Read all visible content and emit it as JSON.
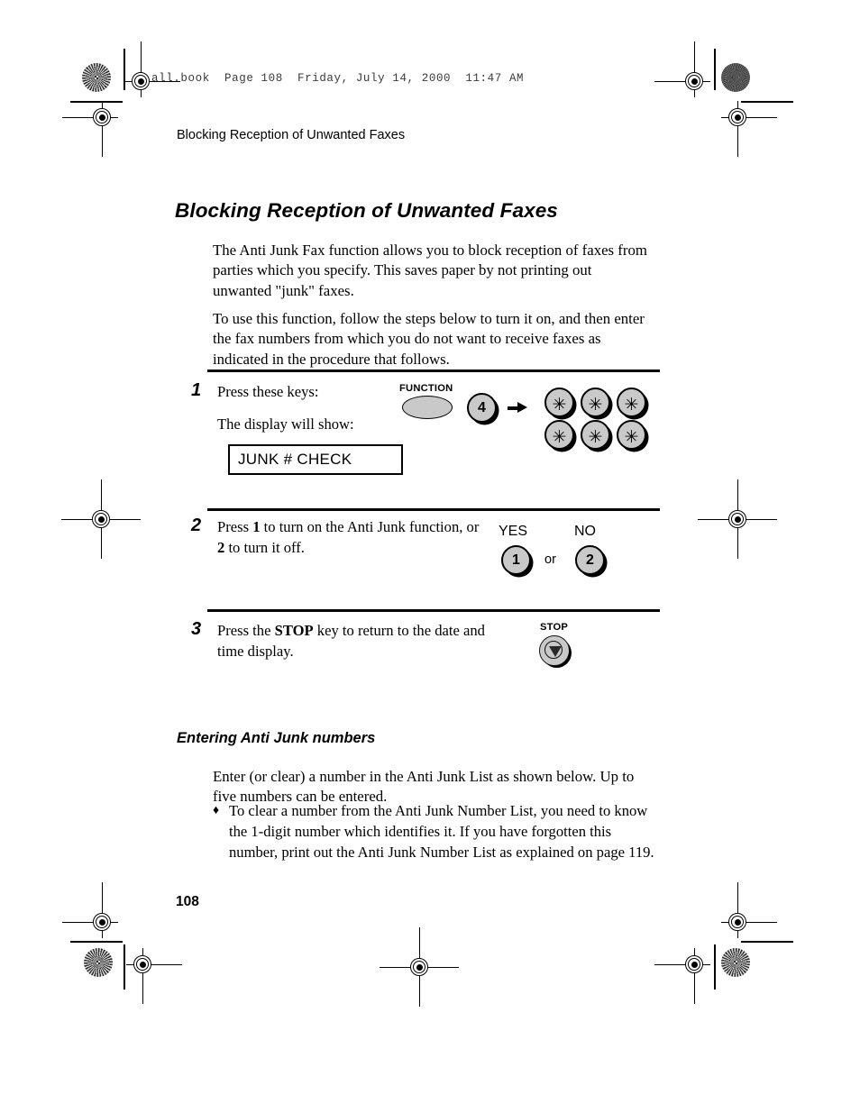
{
  "print_header": "all.book  Page 108  Friday, July 14, 2000  11:47 AM",
  "running_head": "Blocking Reception of Unwanted Faxes",
  "page_title": "Blocking Reception of Unwanted Faxes",
  "intro": {
    "paragraph_1": "The Anti Junk Fax function allows you to block reception of faxes from parties which you specify. This saves paper by not printing out unwanted \"junk\" faxes.",
    "paragraph_2": "To use this function, follow the steps below to turn it on, and then enter the fax numbers from which you do not want to receive faxes as indicated in the procedure that follows."
  },
  "steps": [
    {
      "number": "1",
      "line_1": "Press these keys:",
      "line_2": "The display will show:",
      "function_key_label": "FUNCTION",
      "digit_key": "4",
      "star_key": "✳",
      "star_keys": [
        "✳",
        "✳",
        "✳",
        "✳",
        "✳",
        "✳"
      ],
      "display_text": "JUNK # CHECK"
    },
    {
      "number": "2",
      "text_before_1": "Press ",
      "bold_1": "1",
      "text_middle": " to turn on the Anti Junk function, or ",
      "bold_2": "2",
      "text_after": " to turn it off.",
      "yes_label": "YES",
      "no_label": "NO",
      "yes_key": "1",
      "no_key": "2",
      "or_label": "or"
    },
    {
      "number": "3",
      "text_before": "Press the ",
      "bold": "STOP",
      "text_after": " key to return to the date and time display.",
      "stop_label": "STOP"
    }
  ],
  "subsection": {
    "title": "Entering Anti Junk numbers",
    "paragraph": "Enter (or clear) a number in the Anti Junk List as shown below. Up to five numbers can be entered.",
    "bullet_mark": "♦",
    "bullet_text": "To clear a number from the Anti Junk Number List, you need to know the 1-digit number which identifies it. If you have forgotten this number, print out the Anti Junk Number List as explained on page 119."
  },
  "folio": "108",
  "colors": {
    "key_fill": "#c9c9c9",
    "ink": "#000000",
    "header_ink": "#3a3a3a"
  }
}
